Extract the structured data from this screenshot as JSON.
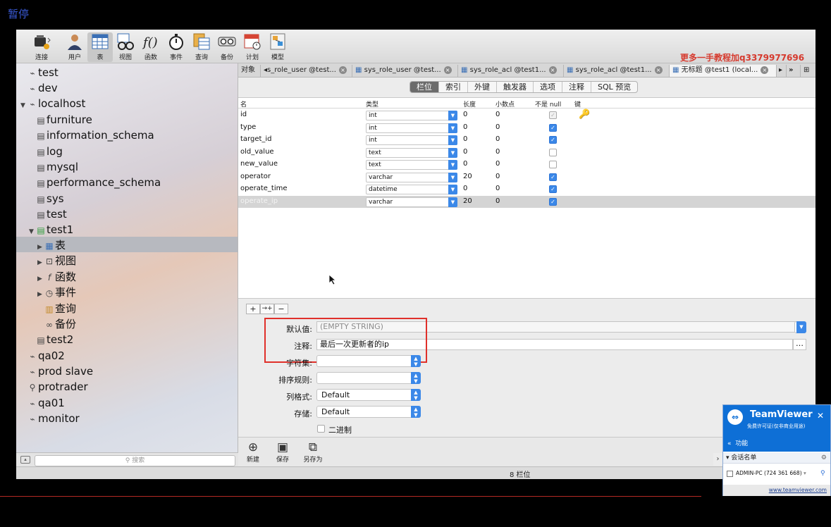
{
  "overlay_label": "暂停",
  "watermark": "更多一手教程加q3379977696",
  "toolbar": [
    {
      "name": "connect",
      "label": "连接"
    },
    {
      "name": "user",
      "label": "用户"
    },
    {
      "name": "table",
      "label": "表"
    },
    {
      "name": "view",
      "label": "视图"
    },
    {
      "name": "function",
      "label": "函数"
    },
    {
      "name": "event",
      "label": "事件"
    },
    {
      "name": "query",
      "label": "查询"
    },
    {
      "name": "backup",
      "label": "备份"
    },
    {
      "name": "schedule",
      "label": "计划"
    },
    {
      "name": "model",
      "label": "模型"
    }
  ],
  "tree": [
    {
      "label": "test",
      "icon": "connection-icon"
    },
    {
      "label": "dev",
      "icon": "connection-icon"
    },
    {
      "label": "localhost",
      "icon": "connection-icon",
      "expanded": true
    },
    {
      "label": "furniture",
      "icon": "database-icon"
    },
    {
      "label": "information_schema",
      "icon": "database-icon"
    },
    {
      "label": "log",
      "icon": "database-icon"
    },
    {
      "label": "mysql",
      "icon": "database-icon"
    },
    {
      "label": "performance_schema",
      "icon": "database-icon"
    },
    {
      "label": "sys",
      "icon": "database-icon"
    },
    {
      "label": "test",
      "icon": "database-icon"
    },
    {
      "label": "test1",
      "icon": "database-icon",
      "expanded": true
    },
    {
      "label": "表",
      "icon": "table-icon",
      "selected": true
    },
    {
      "label": "视图",
      "icon": "view-icon"
    },
    {
      "label": "函数",
      "icon": "function-icon"
    },
    {
      "label": "事件",
      "icon": "event-icon"
    },
    {
      "label": "查询",
      "icon": "query-icon"
    },
    {
      "label": "备份",
      "icon": "backup-icon"
    },
    {
      "label": "test2",
      "icon": "database-icon"
    },
    {
      "label": "qa02",
      "icon": "connection-icon"
    },
    {
      "label": "prod slave",
      "icon": "connection-icon"
    },
    {
      "label": "protrader",
      "icon": "connection-icon"
    },
    {
      "label": "qa01",
      "icon": "connection-icon"
    },
    {
      "label": "monitor",
      "icon": "connection-icon"
    }
  ],
  "search_placeholder": "搜索",
  "tabs": [
    {
      "label": "对象"
    },
    {
      "label": "s_role_user @test..."
    },
    {
      "label": "sys_role_user @test..."
    },
    {
      "label": "sys_role_acl @test1..."
    },
    {
      "label": "sys_role_acl @test1..."
    },
    {
      "label": "无标题 @test1 (local...",
      "active": true
    }
  ],
  "segments": [
    "栏位",
    "索引",
    "外键",
    "触发器",
    "选项",
    "注释",
    "SQL 预览"
  ],
  "grid": {
    "headers": {
      "name": "名",
      "type": "类型",
      "length": "长度",
      "decimals": "小数点",
      "not_null": "不是 null",
      "key": "键"
    },
    "rows": [
      {
        "name": "id",
        "type": "int",
        "length": "0",
        "decimals": "0",
        "not_null": true,
        "disabled": true,
        "key": true
      },
      {
        "name": "type",
        "type": "int",
        "length": "0",
        "decimals": "0",
        "not_null": true
      },
      {
        "name": "target_id",
        "type": "int",
        "length": "0",
        "decimals": "0",
        "not_null": true
      },
      {
        "name": "old_value",
        "type": "text",
        "length": "0",
        "decimals": "0",
        "not_null": false
      },
      {
        "name": "new_value",
        "type": "text",
        "length": "0",
        "decimals": "0",
        "not_null": false
      },
      {
        "name": "operator",
        "type": "varchar",
        "length": "20",
        "decimals": "0",
        "not_null": true
      },
      {
        "name": "operate_time",
        "type": "datetime",
        "length": "0",
        "decimals": "0",
        "not_null": true
      },
      {
        "name": "operate_ip",
        "type": "varchar",
        "length": "20",
        "decimals": "0",
        "not_null": true,
        "selected": true
      }
    ]
  },
  "props": {
    "default_label": "默认值:",
    "default_placeholder": "(EMPTY STRING)",
    "comment_label": "注释:",
    "comment_value": "最后一次更新者的ip",
    "charset_label": "字符集:",
    "collation_label": "排序规则:",
    "format_label": "列格式:",
    "format_value": "Default",
    "storage_label": "存储:",
    "storage_value": "Default",
    "binary_label": "二进制"
  },
  "actions": {
    "new": "新建",
    "save": "保存",
    "save_as": "另存为"
  },
  "status": "8 栏位",
  "teamviewer": {
    "title": "TeamViewer",
    "subtitle": "免费许可证(仅非商业用途)",
    "functions": "功能",
    "session_list": "会话名单",
    "item": "ADMIN-PC (724 361 668)",
    "link": "www.teamviewer.com"
  },
  "colors": {
    "accent": "#3b88e8",
    "highlight": "#e0302a",
    "teamviewer": "#0e6fd6"
  }
}
